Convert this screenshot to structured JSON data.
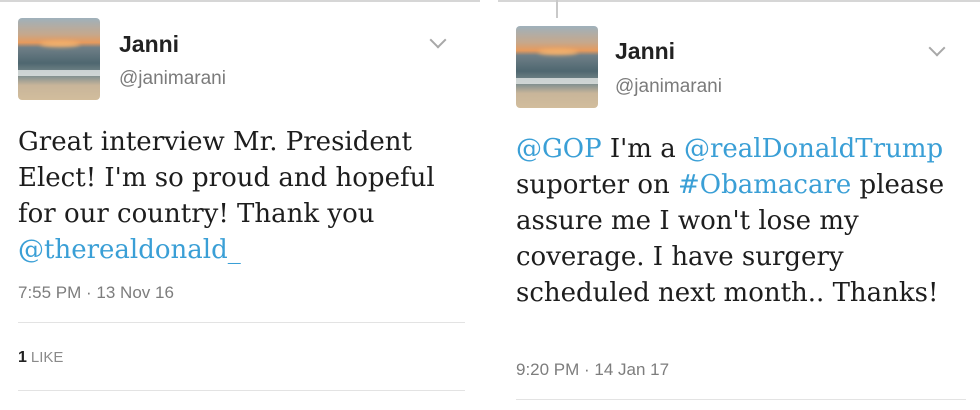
{
  "tweets": [
    {
      "name": "Janni",
      "handle": "@janimarani",
      "text": {
        "part1": "Great interview Mr. President Elect!  I'm so proud and hopeful for our country! Thank you ",
        "mention": "@therealdonald_"
      },
      "time": "7:55 PM · 13 Nov 16",
      "likes": {
        "count": "1",
        "label": "LIKE"
      }
    },
    {
      "name": "Janni",
      "handle": "@janimarani",
      "text": {
        "mention1": "@GOP",
        "part1": " I'm a ",
        "mention2": "@realDonaldTrump",
        "part2": " suporter on ",
        "hashtag": "#Obamacare",
        "part3": " please assure me I won't lose my coverage. I have surgery scheduled next month.. Thanks!"
      },
      "time": "9:20 PM · 14 Jan 17"
    }
  ],
  "icons": {
    "menu": "chevron-down-icon",
    "avatar": "beach-sunset-photo"
  },
  "colors": {
    "link": "#3a9fd6",
    "meta": "#7d7d7d"
  }
}
